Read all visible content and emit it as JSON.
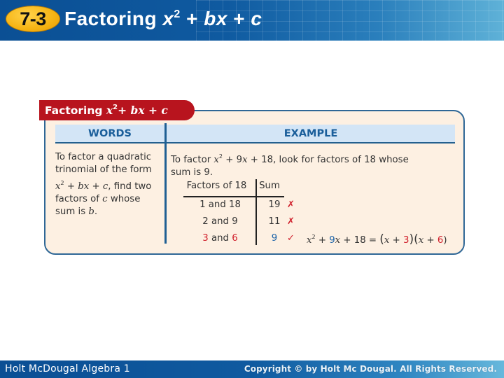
{
  "header": {
    "lesson_number": "7-3",
    "title_prefix": "Factoring ",
    "title_x": "x",
    "title_exp": "2",
    "title_mid": " + ",
    "title_bx": "bx",
    "title_plus": " + ",
    "title_c": "c"
  },
  "card": {
    "tab_label_prefix": "Factoring ",
    "tab_x": "x",
    "tab_exp": "2",
    "tab_plus1": "+ ",
    "tab_bx": "bx",
    "tab_plus2": " + ",
    "tab_c": "c",
    "words_header": "WORDS",
    "example_header": "EXAMPLE",
    "words_text": {
      "line1": "To factor a quadratic",
      "line2": "trinomial of the form",
      "x": "x",
      "exp": "2",
      "plus1": " + ",
      "bx": "bx",
      "plus2": " + ",
      "c": "c",
      "after": ", find two",
      "line4_prefix": "factors of ",
      "line4_c": "c",
      "line4_suffix": " whose",
      "line5_prefix": "sum is ",
      "line5_b": "b",
      "line5_suffix": "."
    },
    "example_text": {
      "prefix": "To factor ",
      "x": "x",
      "exp": "2",
      "mid": " + 9",
      "x2": "x",
      "suffix": " + 18, look for factors of 18 whose",
      "line2": "sum is 9."
    },
    "factor_table": {
      "headers": [
        "Factors of 18",
        "Sum"
      ],
      "rows": [
        {
          "a": "1",
          "and": " and ",
          "b": "18",
          "sum": "19",
          "mark": "✗",
          "valid": false
        },
        {
          "a": "2",
          "and": " and ",
          "b": "9",
          "sum": "11",
          "mark": "✗",
          "valid": false
        },
        {
          "a": "3",
          "and": " and ",
          "b": "6",
          "sum": "9",
          "mark": "✓",
          "valid": true
        }
      ]
    },
    "equation": {
      "x": "x",
      "exp": "2",
      "plus": " + ",
      "b": "9",
      "x2": "x",
      "rest": " + 18 = ",
      "lparen1": "(",
      "x3": "x",
      "plus2": " + ",
      "f1": "3",
      "rparen1": ")",
      "lparen2": "(",
      "x4": "x",
      "plus3": " + ",
      "f2": "6",
      "rparen2": ")"
    }
  },
  "footer": {
    "left": "Holt McDougal Algebra 1",
    "right": "Copyright © by Holt Mc Dougal. All Rights Reserved."
  },
  "colors": {
    "header_blue": "#0f5aa0",
    "badge_orange": "#f6b312",
    "tab_red": "#b8141e",
    "card_bg": "#fdf0e2",
    "header_bar": "#d3e5f6",
    "accent_red": "#d0202c",
    "accent_blue": "#1b63a8"
  }
}
